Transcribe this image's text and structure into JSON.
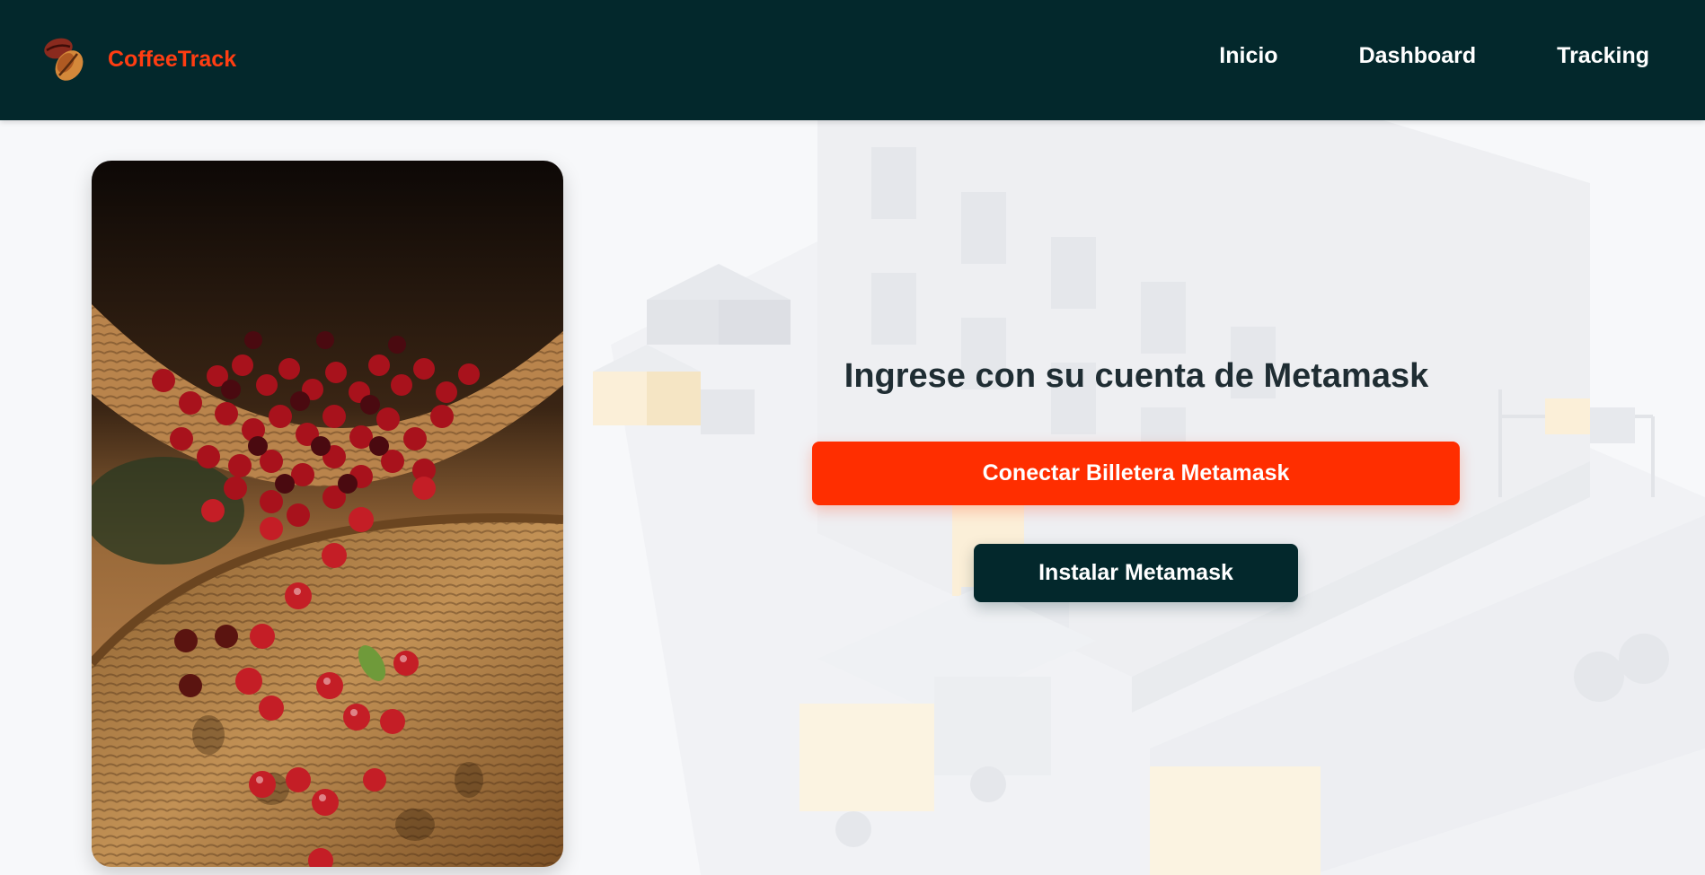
{
  "brand": {
    "name": "CoffeeTrack",
    "logo_icon": "coffee-beans-icon"
  },
  "nav": {
    "items": [
      {
        "label": "Inicio"
      },
      {
        "label": "Dashboard"
      },
      {
        "label": "Tracking"
      }
    ]
  },
  "login": {
    "title": "Ingrese con su cuenta de Metamask",
    "connect_label": "Conectar Billetera Metamask",
    "install_label": "Instalar Metamask"
  },
  "colors": {
    "header_bg": "#03282c",
    "accent": "#ff2e00",
    "brand_text": "#ff3d12",
    "page_bg": "#f7f8fa"
  }
}
